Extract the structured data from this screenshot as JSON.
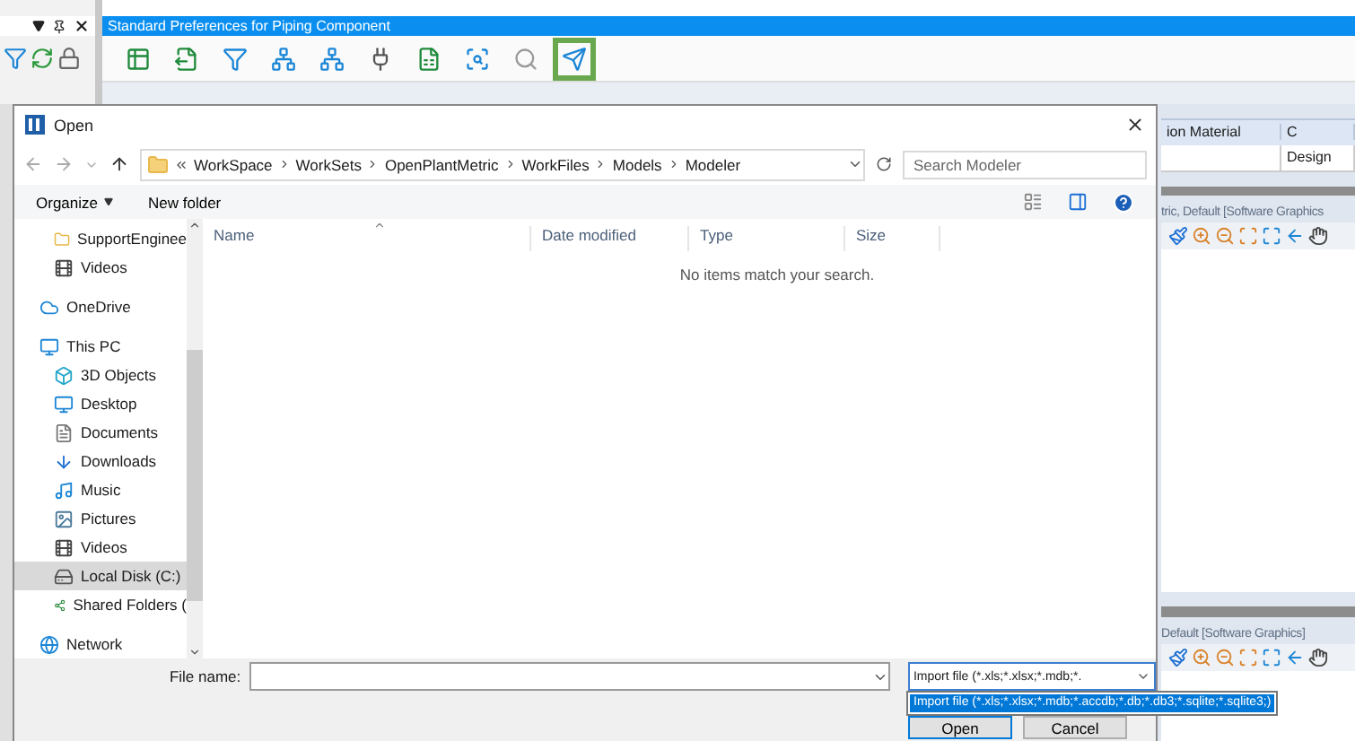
{
  "app": {
    "title": "Standard Preferences for Piping Component",
    "left_tools": [
      {
        "kind": "filter"
      },
      {
        "kind": "refresh"
      },
      {
        "kind": "lock"
      }
    ],
    "toolbar": [
      {
        "kind": "table",
        "highlighted": false
      },
      {
        "kind": "export",
        "highlighted": false
      },
      {
        "kind": "filter",
        "highlighted": false
      },
      {
        "kind": "network",
        "highlighted": false
      },
      {
        "kind": "network",
        "highlighted": false
      },
      {
        "kind": "plug",
        "highlighted": false
      },
      {
        "kind": "sheet",
        "highlighted": false
      },
      {
        "kind": "scan",
        "highlighted": false
      },
      {
        "kind": "search",
        "highlighted": false
      },
      {
        "kind": "send",
        "highlighted": true
      }
    ],
    "grid": {
      "columns": [
        "ion Material",
        "C"
      ],
      "rows": [
        {
          "column_2": "Design"
        }
      ]
    },
    "views": [
      {
        "title": "tric, Default [Software Graphics"
      },
      {
        "title": "Default [Software Graphics]"
      }
    ]
  },
  "dialog": {
    "title": "Open",
    "breadcrumb": [
      "WorkSpace",
      "WorkSets",
      "OpenPlantMetric",
      "WorkFiles",
      "Models",
      "Modeler"
    ],
    "search": {
      "placeholder": "Search Modeler"
    },
    "commands": [
      {
        "label": "Organize",
        "dropdown": true
      },
      {
        "label": "New folder",
        "dropdown": false
      }
    ],
    "sidebar": {
      "partial_items": [
        {
          "label": "SupportEnginee",
          "kind": "folder",
          "selected": false
        },
        {
          "label": "Videos",
          "kind": "video",
          "selected": false
        }
      ],
      "items": [
        {
          "label": "OneDrive",
          "kind": "cloud",
          "selected": false
        },
        {
          "label": "This PC",
          "kind": "pc",
          "selected": false,
          "children": [
            {
              "label": "3D Objects",
              "kind": "cube",
              "selected": false
            },
            {
              "label": "Desktop",
              "kind": "desktop",
              "selected": false
            },
            {
              "label": "Documents",
              "kind": "document",
              "selected": false
            },
            {
              "label": "Downloads",
              "kind": "download",
              "selected": false
            },
            {
              "label": "Music",
              "kind": "music",
              "selected": false
            },
            {
              "label": "Pictures",
              "kind": "picture",
              "selected": false
            },
            {
              "label": "Videos",
              "kind": "video",
              "selected": false
            },
            {
              "label": "Local Disk (C:)",
              "kind": "disk",
              "selected": true
            },
            {
              "label": "Shared Folders (",
              "kind": "share",
              "selected": false
            }
          ]
        },
        {
          "label": "Network",
          "kind": "network",
          "selected": false
        }
      ]
    },
    "columns": [
      "Name",
      "Date modified",
      "Type",
      "Size"
    ],
    "empty_message": "No items match your search.",
    "file_name": {
      "label": "File name:"
    },
    "filter": {
      "value": "Import file  (*.xls;*.xlsx;*.mdb;*.",
      "options": [
        {
          "label": "Import file  (*.xls;*.xlsx;*.mdb;*.accdb;*.db;*.db3;*.sqlite;*.sqlite3;)",
          "selected": true
        }
      ]
    },
    "buttons": [
      "Open",
      "Cancel"
    ]
  }
}
